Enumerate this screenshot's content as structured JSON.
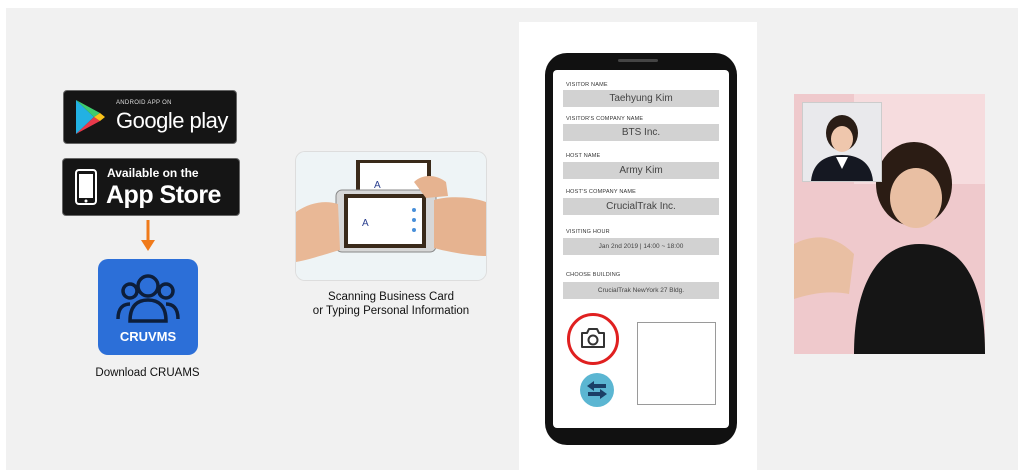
{
  "store_badges": {
    "google_play": {
      "small_text": "ANDROID APP ON",
      "big_text": "Google play",
      "icon": "google-play-icon"
    },
    "app_store": {
      "small_text": "Available on the",
      "big_text": "App Store",
      "icon": "iphone-icon"
    }
  },
  "app": {
    "name": "CRUVMS",
    "caption": "Download CRUAMS",
    "icon": "users-icon",
    "color": "#2c6fd8"
  },
  "arrow_color": "#f07a1a",
  "scan": {
    "caption_line1": "Scanning Business Card",
    "caption_line2": "or Typing Personal Information"
  },
  "form": {
    "fields": [
      {
        "label": "VISITOR NAME",
        "value": "Taehyung Kim"
      },
      {
        "label": "VISITOR'S COMPANY NAME",
        "value": "BTS Inc."
      },
      {
        "label": "HOST NAME",
        "value": "Army Kim"
      },
      {
        "label": "HOST'S COMPANY NAME",
        "value": "CrucialTrak Inc."
      },
      {
        "label": "VISITING HOUR",
        "value": "Jan 2nd 2019 | 14:00 ~ 18:00"
      },
      {
        "label": "CHOOSE BUILDING",
        "value": "CrucialTrak NewYork 27 Bldg."
      }
    ],
    "camera_icon": "camera-icon",
    "swap_icon": "swap-arrows-icon",
    "highlight_color": "#e02020"
  }
}
